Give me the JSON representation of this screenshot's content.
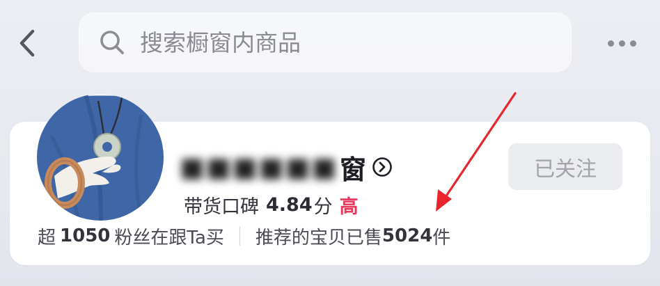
{
  "header": {
    "back_icon": "chevron-left-icon",
    "search": {
      "icon": "search-icon",
      "placeholder": "搜索橱窗内商品",
      "value": ""
    },
    "more_icon": "more-horizontal-icon"
  },
  "shop": {
    "name_suffix": "窗",
    "name_obscured": true,
    "name_icon": "circle-chevron-right-icon",
    "follow_label": "已关注",
    "rating": {
      "label": "带货口碑",
      "score": "4.84",
      "unit": "分",
      "level": "高"
    },
    "stats": {
      "fans_prefix": "超",
      "fans_count": "1050",
      "fans_suffix": "粉丝在跟Ta买",
      "sold_prefix": "推荐的宝贝已售",
      "sold_count": "5024",
      "sold_suffix": "件"
    }
  },
  "colors": {
    "accent_red": "#e8385e",
    "annotation_arrow": "#e8242c",
    "follow_bg": "#ebecf0",
    "follow_text": "#a1a2aa"
  }
}
